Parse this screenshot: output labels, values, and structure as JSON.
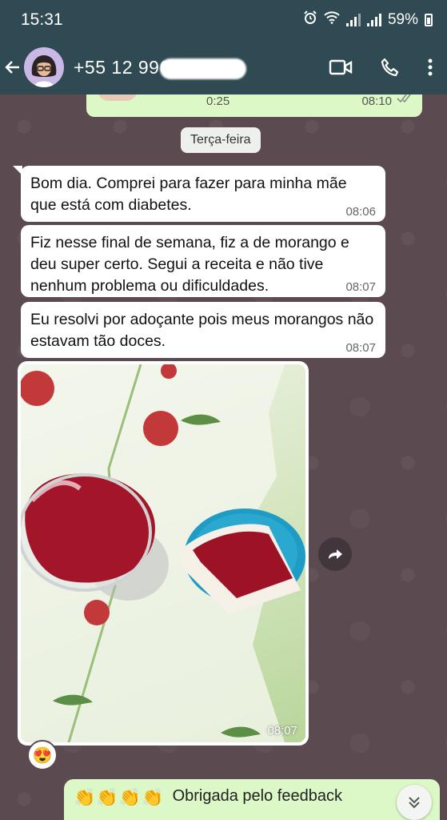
{
  "status_bar": {
    "time": "15:31",
    "battery": "59%"
  },
  "header": {
    "back_icon": "arrow-left-icon",
    "contact": "+55 12 996",
    "icons": [
      "video-call-icon",
      "phone-call-icon",
      "more-vert-icon"
    ]
  },
  "previous_message": {
    "duration": "0:25",
    "time": "08:10"
  },
  "day_separator": "Terça-feira",
  "messages": [
    {
      "text": "Bom dia. Comprei para fazer para minha mãe que está com diabetes.",
      "time": "08:06"
    },
    {
      "text": "Fiz nesse final de semana, fiz a de morango e deu super certo. Segui a receita e não tive nenhum problema ou dificuldades.",
      "time": "08:07"
    },
    {
      "text": "Eu resolvi por adoçante pois meus morangos não estavam tão doces.",
      "time": "08:07"
    }
  ],
  "photo_message": {
    "time": "08:07",
    "reaction": "😍"
  },
  "outgoing": {
    "emojis": "👏👏👏👏",
    "text": "Obrigada pelo feedback"
  },
  "colors": {
    "header": "#2f4a52",
    "chat_bg": "#5b4a4f",
    "incoming": "#ffffff",
    "outgoing": "#dcf8c6"
  }
}
